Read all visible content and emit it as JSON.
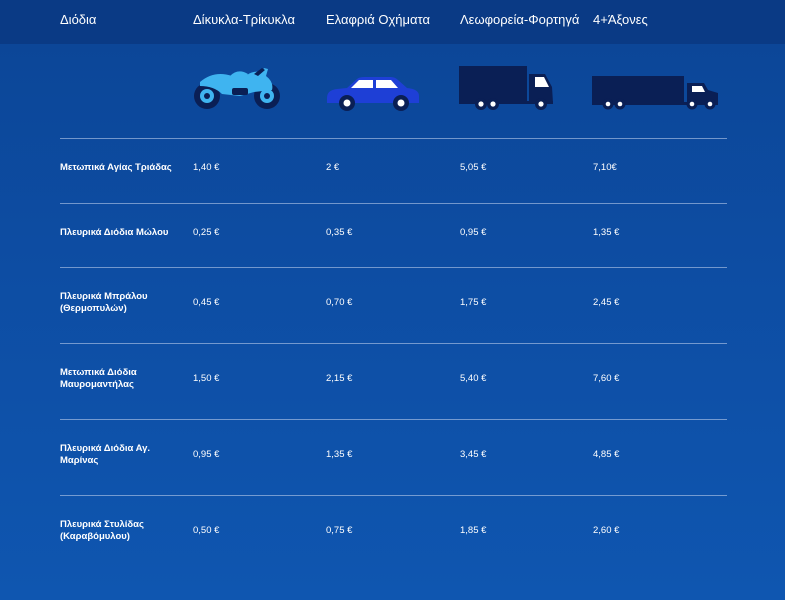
{
  "colors": {
    "header_bg": "#0a3a85",
    "page_bg": "#0d4da3",
    "motorcycle": "#3fb4f0",
    "car": "#1e3fd6",
    "truck": "#0a1f55"
  },
  "header": {
    "columns": [
      "Διόδια",
      "Δίκυκλα-Τρίκυκλα",
      "Ελαφριά Οχήματα",
      "Λεωφορεία-Φορτηγά",
      "4+Άξονες"
    ]
  },
  "vehicle_icons": [
    "motorcycle-icon",
    "car-icon",
    "truck-icon",
    "semi-truck-icon"
  ],
  "rows": [
    {
      "label": "Μετωπικά Αγίας Τριάδας",
      "prices": [
        "1,40 €",
        "2 €",
        "5,05 €",
        "7,10€"
      ]
    },
    {
      "label": "Πλευρικά Διόδια Μώλου",
      "prices": [
        "0,25 €",
        "0,35 €",
        "0,95 €",
        "1,35 €"
      ]
    },
    {
      "label": "Πλευρικά Μπράλου (Θερμοπυλών)",
      "prices": [
        "0,45 €",
        "0,70 €",
        "1,75 €",
        "2,45 €"
      ]
    },
    {
      "label": "Μετωπικά Διόδια Μαυρομαντήλας",
      "prices": [
        "1,50 €",
        "2,15 €",
        "5,40 €",
        "7,60 €"
      ]
    },
    {
      "label": "Πλευρικά Διόδια Αγ. Μαρίνας",
      "prices": [
        "0,95 €",
        "1,35 €",
        "3,45 €",
        "4,85 €"
      ]
    },
    {
      "label": "Πλευρικά Στυλίδας (Καραβόμυλου)",
      "prices": [
        "0,50 €",
        "0,75 €",
        "1,85 €",
        "2,60 €"
      ]
    }
  ]
}
